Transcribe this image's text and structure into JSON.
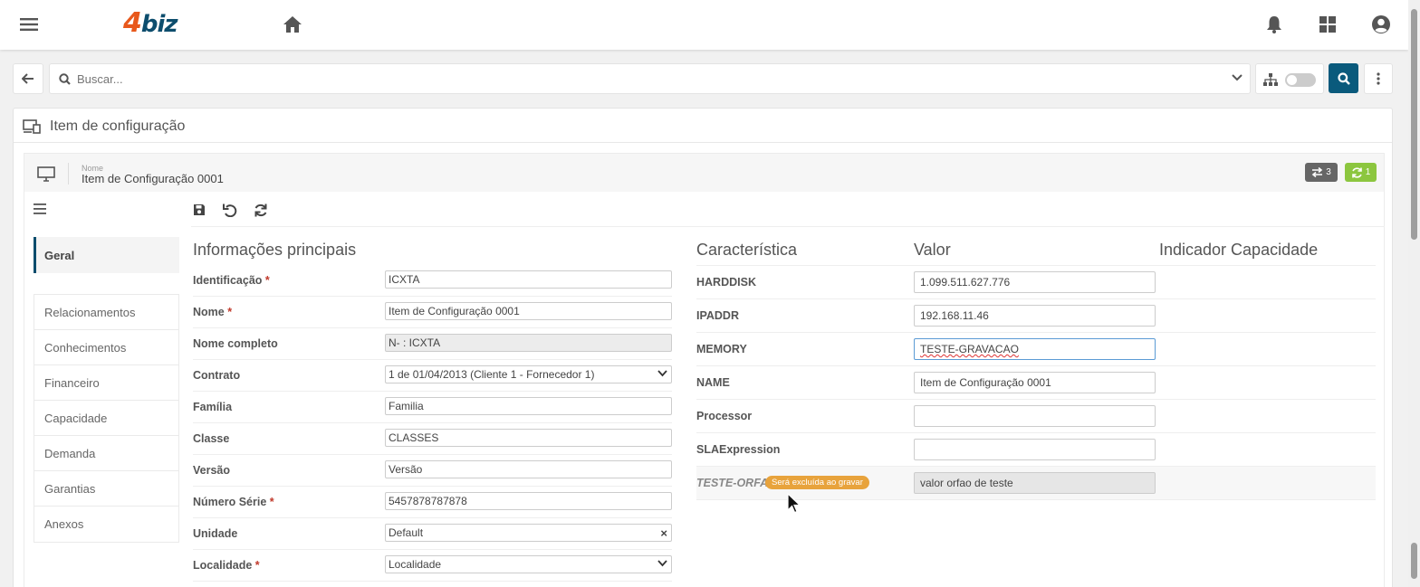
{
  "topbar": {
    "menu_icon": "hamburger-icon",
    "logo": {
      "digit": "4",
      "text": "biz"
    },
    "home_icon": "home-icon",
    "bell_icon": "bell-icon",
    "apps_icon": "apps-grid-icon",
    "user_icon": "user-circle-icon"
  },
  "search": {
    "placeholder": "Buscar...",
    "back_icon": "arrow-left-icon",
    "search_icon": "search-icon",
    "chevron_icon": "chevron-down-icon",
    "tree_icon": "sitemap-icon",
    "toggle_on": false,
    "kebab_icon": "kebab-icon"
  },
  "card": {
    "title": "Item de configuração",
    "title_icon": "devices-icon"
  },
  "item": {
    "name_label": "Nome",
    "name_value": "Item de Configuração 0001",
    "badge_relations": "3",
    "badge_sync": "1"
  },
  "toolbar": {
    "menu_icon": "list-icon",
    "save_icon": "save-icon",
    "undo_icon": "undo-icon",
    "refresh_icon": "refresh-icon"
  },
  "sidenav": {
    "active": "Geral",
    "items": [
      "Relacionamentos",
      "Conhecimentos",
      "Financeiro",
      "Capacidade",
      "Demanda",
      "Garantias",
      "Anexos"
    ]
  },
  "main_info": {
    "title": "Informações principais",
    "fields": [
      {
        "label": "Identificação",
        "required": "*",
        "value": "ICXTA"
      },
      {
        "label": "Nome",
        "required": "*",
        "value": "Item de Configuração 0001"
      },
      {
        "label": "Nome completo",
        "required": "",
        "value": "N- : ICXTA"
      },
      {
        "label": "Contrato",
        "required": "",
        "value": "1 de 01/04/2013 (Cliente 1 - Fornecedor 1)"
      },
      {
        "label": "Família",
        "required": "",
        "value": "Familia"
      },
      {
        "label": "Classe",
        "required": "",
        "value": "CLASSES"
      },
      {
        "label": "Versão",
        "required": "",
        "value": "Versão"
      },
      {
        "label": "Número Série",
        "required": "*",
        "value": "5457878787878"
      },
      {
        "label": "Unidade",
        "required": "",
        "value": "Default"
      },
      {
        "label": "Localidade",
        "required": "*",
        "value": "Localidade"
      }
    ]
  },
  "characteristics": {
    "headers": [
      "Característica",
      "Valor",
      "Indicador Capacidade"
    ],
    "rows": [
      {
        "name": "HARDDISK",
        "value": "1.099.511.627.776"
      },
      {
        "name": "IPADDR",
        "value": "192.168.11.46"
      },
      {
        "name": "MEMORY",
        "value": "TESTE-GRAVACAO"
      },
      {
        "name": "NAME",
        "value": "Item de Configuração 0001"
      },
      {
        "name": "Processor",
        "value": ""
      },
      {
        "name": "SLAExpression",
        "value": ""
      },
      {
        "name": "TESTE-ORFA",
        "value": "valor orfao de teste",
        "tag": "Será excluída ao gravar"
      }
    ]
  }
}
